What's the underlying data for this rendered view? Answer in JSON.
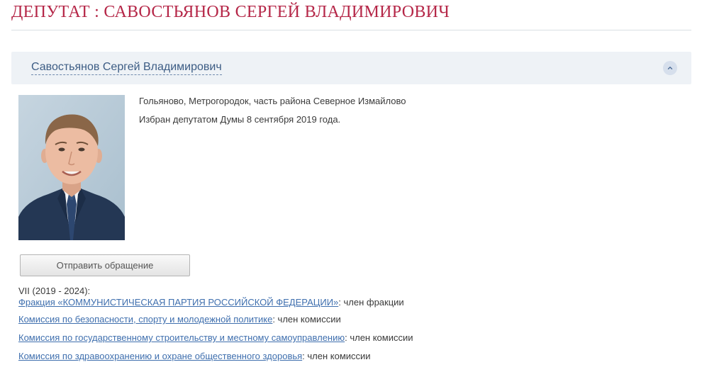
{
  "page": {
    "title": "ДЕПУТАТ : САВОСТЬЯНОВ СЕРГЕЙ ВЛАДИМИРОВИЧ"
  },
  "accordion": {
    "name": "Савостьянов Сергей Владимирович",
    "toggle_icon": "chevron-up-icon"
  },
  "deputy": {
    "district": "Гольяново, Метрогородок, часть района Северное Измайлово",
    "elected": "Избран депутатом Думы 8 сентября 2019 года."
  },
  "actions": {
    "send_appeal": "Отправить обращение"
  },
  "convocation": "VII (2019 - 2024):",
  "memberships": [
    {
      "link": "Фракция «КОММУНИСТИЧЕСКАЯ ПАРТИЯ РОССИЙСКОЙ ФЕДЕРАЦИИ»",
      "role": ": член фракции"
    },
    {
      "link": "Комиссия по безопасности, спорту и молодежной политике",
      "role": ": член комиссии"
    },
    {
      "link": "Комиссия по государственному строительству и местному самоуправлению",
      "role": ": член комиссии"
    },
    {
      "link": "Комиссия по здравоохранению и охране общественного здоровья",
      "role": ": член комиссии"
    }
  ],
  "colors": {
    "title": "#b52748",
    "link": "#3f6fae",
    "accordion_bg": "#eef2f6"
  }
}
